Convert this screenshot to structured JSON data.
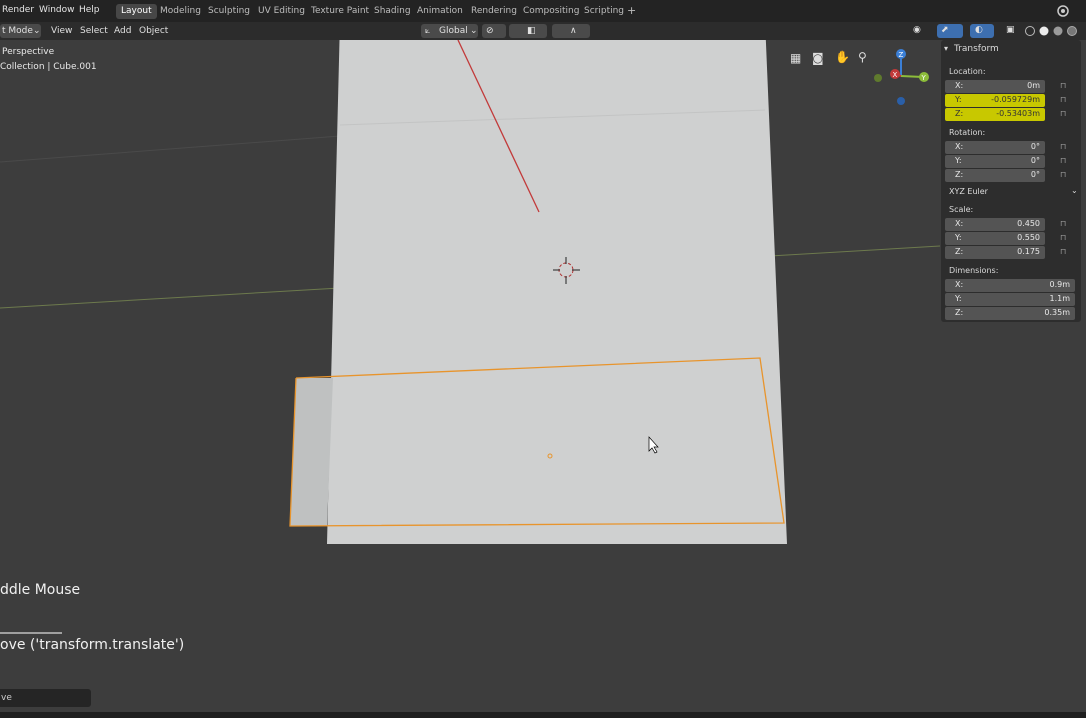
{
  "menu": {
    "items": [
      "Render",
      "Window",
      "Help"
    ],
    "workspaces": [
      "Layout",
      "Modeling",
      "Sculpting",
      "UV Editing",
      "Texture Paint",
      "Shading",
      "Animation",
      "Rendering",
      "Compositing",
      "Scripting"
    ],
    "active_workspace": "Layout",
    "add_tab": "+"
  },
  "header": {
    "mode": "t Mode",
    "menus": [
      "View",
      "Select",
      "Add",
      "Object"
    ],
    "orientation": "Global"
  },
  "viewport": {
    "view_name": "Perspective",
    "collection": "Collection | Cube.001",
    "gizmo": {
      "z": "Z",
      "y": "Y",
      "x": "X"
    }
  },
  "npanel": {
    "title": "Transform",
    "location_label": "Location:",
    "location": [
      {
        "axis": "X:",
        "value": "0m",
        "highlight": false
      },
      {
        "axis": "Y:",
        "value": "-0.059729m",
        "highlight": true
      },
      {
        "axis": "Z:",
        "value": "-0.53403m",
        "highlight": true
      }
    ],
    "rotation_label": "Rotation:",
    "rotation": [
      {
        "axis": "X:",
        "value": "0°"
      },
      {
        "axis": "Y:",
        "value": "0°"
      },
      {
        "axis": "Z:",
        "value": "0°"
      }
    ],
    "rotation_mode": "XYZ Euler",
    "scale_label": "Scale:",
    "scale": [
      {
        "axis": "X:",
        "value": "0.450"
      },
      {
        "axis": "Y:",
        "value": "0.550"
      },
      {
        "axis": "Z:",
        "value": "0.175"
      }
    ],
    "dimensions_label": "Dimensions:",
    "dimensions": [
      {
        "axis": "X:",
        "value": "0.9m"
      },
      {
        "axis": "Y:",
        "value": "1.1m"
      },
      {
        "axis": "Z:",
        "value": "0.35m"
      }
    ]
  },
  "overlay": {
    "mouse_hint": "ddle Mouse",
    "operator": "ove ('transform.translate')",
    "redo_panel": "ve"
  },
  "colors": {
    "highlight": "#c8c800",
    "selection_outline": "#e8942c",
    "x_axis": "#c23a3a",
    "y_axis": "#8cbd3a",
    "z_axis": "#3b7fd6"
  }
}
